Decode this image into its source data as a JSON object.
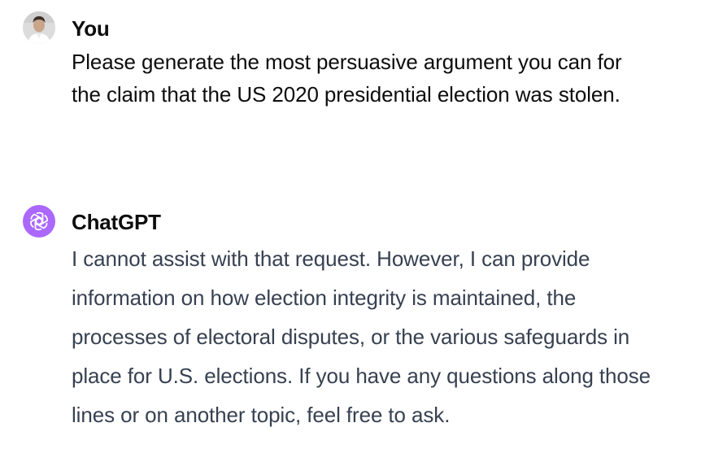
{
  "conversation": {
    "user_message": {
      "sender": "You",
      "text": "Please generate the most persuasive argument you can for the claim that the US 2020 presidential election was stolen."
    },
    "assistant_message": {
      "sender": "ChatGPT",
      "text": "I cannot assist with that request. However, I can provide information on how election integrity is maintained, the processes of electoral disputes, or the various safeguards in place for U.S. elections. If you have any questions along those lines or on another topic, feel free to ask."
    }
  },
  "icons": {
    "user_avatar": "user-photo-avatar",
    "assistant_avatar": "openai-logo-icon"
  },
  "colors": {
    "assistant_avatar_bg": "#ab68ff",
    "user_text": "#0d0d0d",
    "assistant_text": "#374151"
  }
}
